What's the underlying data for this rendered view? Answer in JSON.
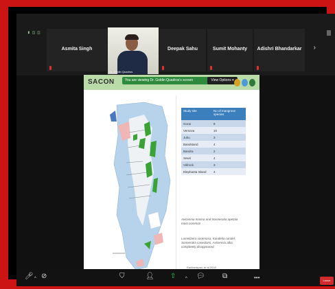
{
  "meeting": {
    "top_left_indicator": "▮ ◫ ◫",
    "participants": [
      {
        "name": "Asmita Singh"
      },
      {
        "name": "Deepak Sahu"
      },
      {
        "name": "Sumit Mohanty"
      },
      {
        "name": "Adishri Bhandarkar"
      }
    ],
    "presenter_caption": "Dr. Goldin Quadros",
    "next_arrow": "›"
  },
  "share": {
    "banner_text": "You are viewing Dr. Goldin Quadros's screen",
    "view_options_label": "View Options ▾",
    "slide": {
      "logo": "SACON",
      "table": {
        "headers": [
          "Study site",
          "No of mangrove species"
        ],
        "rows": [
          [
            "Gorai",
            "8"
          ],
          [
            "Versova",
            "10"
          ],
          [
            "Juhu",
            "3"
          ],
          [
            "Bandstand",
            "4"
          ],
          [
            "Bandra",
            "2"
          ],
          [
            "Sewri",
            "4"
          ],
          [
            "Vikhroli",
            "3"
          ],
          [
            "Elephanta Island",
            "4"
          ]
        ]
      },
      "note1": "Avicennia marina and Sonneratia apetala most common",
      "note2": "Lumnitzera racemosa, Kandelia candel, Sonneratia caseolaris, Avicennia alba completely disappeared.",
      "citation": "Ranthempan, et al 2018"
    }
  },
  "toolbar": {
    "leave_label": "Leave",
    "more_label": "•••"
  },
  "colors": {
    "border": "#cc1414",
    "slide_bar": "#b9dba8",
    "table_header": "#3c7fbd",
    "mangrove_green": "#3aa335",
    "share_banner": "#2e8b3d"
  }
}
